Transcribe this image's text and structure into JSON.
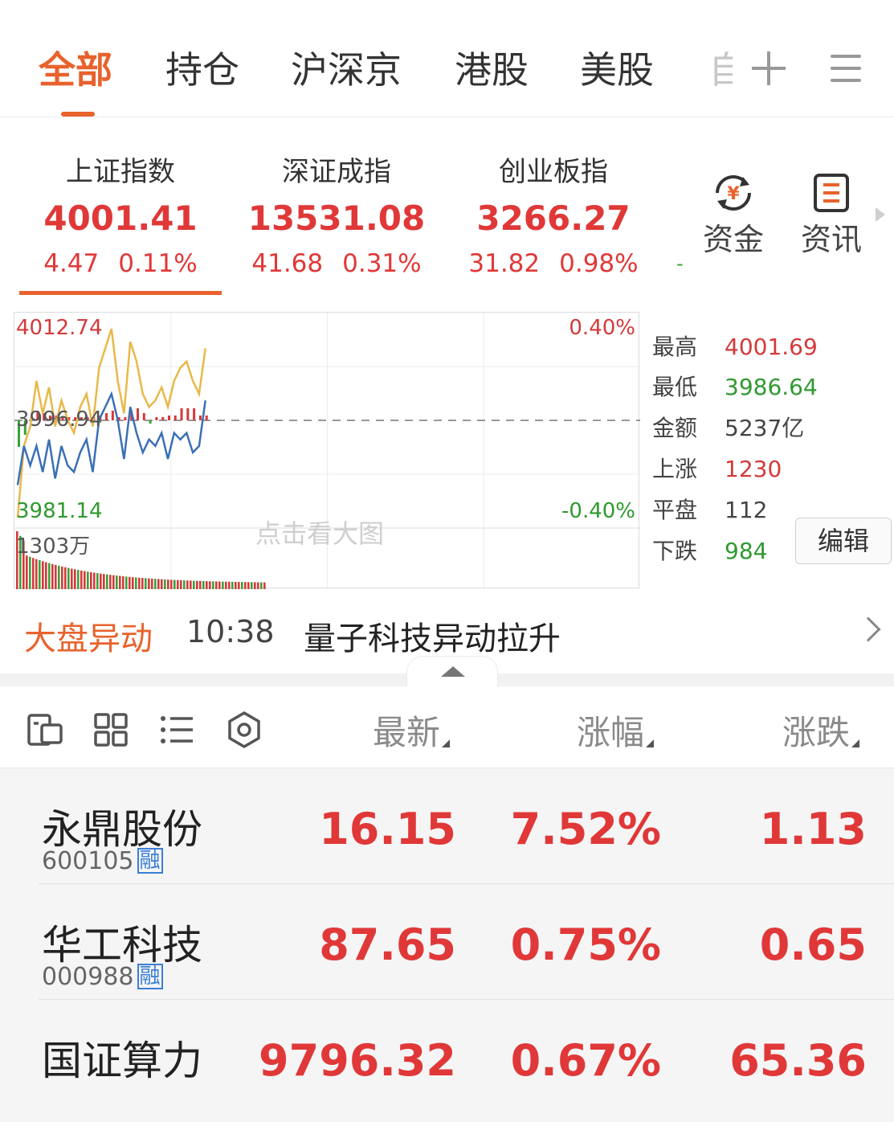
{
  "tabs": {
    "items": [
      "全部",
      "持仓",
      "沪深京",
      "港股",
      "美股",
      "自"
    ],
    "active_index": 0
  },
  "indices": [
    {
      "name": "上证指数",
      "value": "4001.41",
      "change": "4.47",
      "pct": "0.11%"
    },
    {
      "name": "深证成指",
      "value": "13531.08",
      "change": "41.68",
      "pct": "0.31%"
    },
    {
      "name": "创业板指",
      "value": "3266.27",
      "change": "31.82",
      "pct": "0.98%"
    }
  ],
  "indices_overflow_dash": "-",
  "quick_links": {
    "funds_label": "资金",
    "funds_icon_glyph": "¥",
    "news_label": "资讯"
  },
  "chart": {
    "high_label": "4012.74",
    "mid_label": "3996.94",
    "low_label": "3981.14",
    "up_pct": "0.40%",
    "down_pct": "-0.40%",
    "volume_label": "1303万",
    "watermark": "点击看大图"
  },
  "chart_data": {
    "type": "line",
    "title": "",
    "baseline": 3996.94,
    "ylim": [
      3981.14,
      4012.74
    ],
    "pct_range": [
      -0.4,
      0.4
    ],
    "volume_max_label": "1303万",
    "series": [
      {
        "values": [
          3982,
          3993,
          3996,
          4003,
          3998,
          4002,
          3996,
          4000,
          3997,
          3995,
          3999,
          4001,
          3996,
          4005,
          4008,
          4011,
          4003,
          3998,
          4009,
          4006,
          4001,
          3999,
          4000,
          4002,
          3999,
          4003,
          4005,
          4006,
          4003,
          4001,
          4008
        ]
      },
      {
        "values": [
          3987,
          3993,
          3990,
          3993,
          3989,
          3994,
          3988,
          3993,
          3990,
          3989,
          3992,
          3994,
          3989,
          3997,
          3999,
          4001,
          3997,
          3991,
          3999,
          3995,
          3992,
          3994,
          3993,
          3995,
          3991,
          3995,
          3994,
          3995,
          3992,
          3993,
          4000
        ]
      }
    ],
    "colors": {
      "yellow": "#e8b84a",
      "blue": "#3b6fb6",
      "red": "#d33a3a",
      "green": "#3aa13a"
    }
  },
  "stats": [
    {
      "k": "最高",
      "v": "4001.69",
      "color": "#d33a3a"
    },
    {
      "k": "最低",
      "v": "3986.64",
      "color": "#2f9a2f"
    },
    {
      "k": "金额",
      "v": "5237亿",
      "color": "#444444"
    },
    {
      "k": "上涨",
      "v": "1230",
      "color": "#d33a3a"
    },
    {
      "k": "平盘",
      "v": "112",
      "color": "#444444"
    },
    {
      "k": "下跌",
      "v": "984",
      "color": "#2f9a2f"
    }
  ],
  "edit_label": "编辑",
  "alert": {
    "tag": "大盘异动",
    "time": "10:38",
    "message": "量子科技异动拉升"
  },
  "list_header": {
    "latest": "最新",
    "change_pct": "涨幅",
    "change": "涨跌"
  },
  "rong_label": "融",
  "stocks": [
    {
      "name": "永鼎股份",
      "code": "600105",
      "rong": true,
      "latest": "16.15",
      "pct": "7.52%",
      "change": "1.13"
    },
    {
      "name": "华工科技",
      "code": "000988",
      "rong": true,
      "latest": "87.65",
      "pct": "0.75%",
      "change": "0.65"
    },
    {
      "name": "国证算力",
      "code": "",
      "rong": false,
      "latest": "9796.32",
      "pct": "0.67%",
      "change": "65.36"
    }
  ]
}
